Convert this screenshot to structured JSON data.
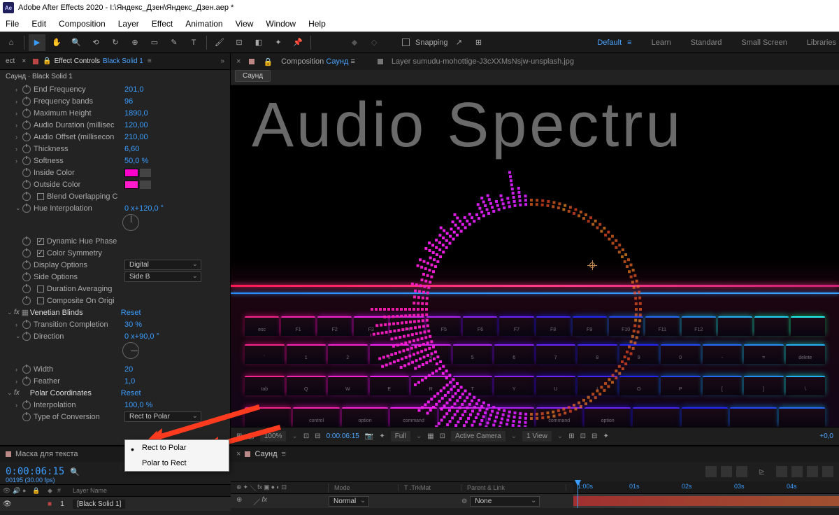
{
  "titlebar": {
    "app": "Adobe After Effects 2020",
    "path": "I:\\Яндекс_Дзен\\Яндекс_Дзен.aep *"
  },
  "menu": [
    "File",
    "Edit",
    "Composition",
    "Layer",
    "Effect",
    "Animation",
    "View",
    "Window",
    "Help"
  ],
  "toolbar": {
    "snapping": "Snapping"
  },
  "workspaces": [
    "Default",
    "Learn",
    "Standard",
    "Small Screen",
    "Libraries"
  ],
  "effect_panel": {
    "tab_prefix": "ect",
    "tab_label": "Effect Controls",
    "layer_name": "Black Solid 1",
    "breadcrumb": "Саунд · Black Solid 1",
    "props": {
      "end_freq": {
        "name": "End Frequency",
        "val": "201,0"
      },
      "freq_bands": {
        "name": "Frequency bands",
        "val": "96"
      },
      "max_height": {
        "name": "Maximum Height",
        "val": "1890,0"
      },
      "audio_dur": {
        "name": "Audio Duration (millisec",
        "val": "120,00"
      },
      "audio_off": {
        "name": "Audio Offset (millisecon",
        "val": "210,00"
      },
      "thickness": {
        "name": "Thickness",
        "val": "6,60"
      },
      "softness": {
        "name": "Softness",
        "val": "50,0 %"
      },
      "inside_color": {
        "name": "Inside Color"
      },
      "outside_color": {
        "name": "Outside Color"
      },
      "blend_overlap": {
        "name": "Blend Overlapping C"
      },
      "hue_interp": {
        "name": "Hue Interpolation",
        "val": "0 x+120,0 °"
      },
      "dyn_hue": {
        "name": "Dynamic Hue Phase"
      },
      "color_sym": {
        "name": "Color Symmetry"
      },
      "display_opt": {
        "name": "Display Options",
        "val": "Digital"
      },
      "side_opt": {
        "name": "Side Options",
        "val": "Side B"
      },
      "dur_avg": {
        "name": "Duration Averaging"
      },
      "comp_orig": {
        "name": "Composite On Origi"
      },
      "venetian": {
        "name": "Venetian Blinds",
        "reset": "Reset"
      },
      "trans_comp": {
        "name": "Transition Completion",
        "val": "30 %"
      },
      "direction": {
        "name": "Direction",
        "val": "0 x+90,0 °"
      },
      "width": {
        "name": "Width",
        "val": "20"
      },
      "feather": {
        "name": "Feather",
        "val": "1,0"
      },
      "polar": {
        "name": "Polar Coordinates",
        "reset": "Reset"
      },
      "interp": {
        "name": "Interpolation",
        "val": "100,0 %"
      },
      "type_conv": {
        "name": "Type of Conversion",
        "val": "Rect to Polar"
      }
    }
  },
  "comp_panel": {
    "tab1": "Composition",
    "comp_name": "Саунд",
    "tab2": "Layer sumudu-mohottige-J3cXXMsNsjw-unsplash.jpg",
    "crumb": "Саунд",
    "big_text": "Audio Spectru"
  },
  "viewer_bar": {
    "zoom": "100%",
    "time": "0:00:06:15",
    "res": "Full",
    "camera": "Active Camera",
    "views": "1 View",
    "exposure": "+0,0"
  },
  "timeline": {
    "tab_left": "Маска для текста",
    "tab_right": "Саунд",
    "timecode": "0:00:06:15",
    "frames": "00195 (30.00 fps)",
    "header_layer": "Layer Name",
    "layer1_num": "1",
    "layer1_name": "[Black Solid 1]",
    "cols": {
      "mode": "Mode",
      "trkmat": "T  .TrkMat",
      "parent": "Parent & Link"
    },
    "mode_val": "Normal",
    "parent_val": "None",
    "ruler": [
      "1:00s",
      "01s",
      "02s",
      "03s",
      "04s"
    ]
  },
  "popup": {
    "opt1": "Rect to Polar",
    "opt2": "Polar to Rect"
  }
}
